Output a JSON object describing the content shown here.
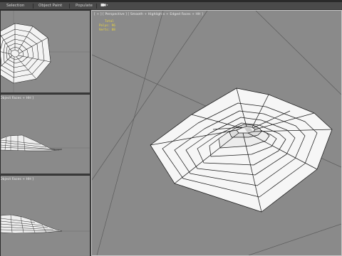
{
  "ribbon": {
    "tabs": [
      {
        "label": "Selection"
      },
      {
        "label": "Object Paint"
      },
      {
        "label": "Populate"
      }
    ],
    "extra_icon": "camera-menu-icon"
  },
  "viewports": {
    "top_left": {
      "label": ""
    },
    "mid_left": {
      "label": "[ Object Faces + HH ]",
      "visible_text": "Object Faces + HH ]"
    },
    "bot_left": {
      "label": "[ Object Faces + HH ]",
      "visible_text": "Object Faces + HH ]"
    },
    "main": {
      "label": "[ + ] [ Perspective ] [ Smooth + Highlights + Edged Faces + HH ]",
      "stats": {
        "total": "Total",
        "polys_label": "Polys:",
        "polys_value": "96",
        "verts_label": "Verts:",
        "verts_value": "88"
      }
    }
  },
  "colors": {
    "viewport_bg": "#8a8a8a",
    "grid": "#5e5e5e",
    "mesh_fill": "#f5f5f5",
    "mesh_wire": "#1a1a1a",
    "stats_text": "#f0d93a",
    "active_border": "#c8c8c8"
  }
}
